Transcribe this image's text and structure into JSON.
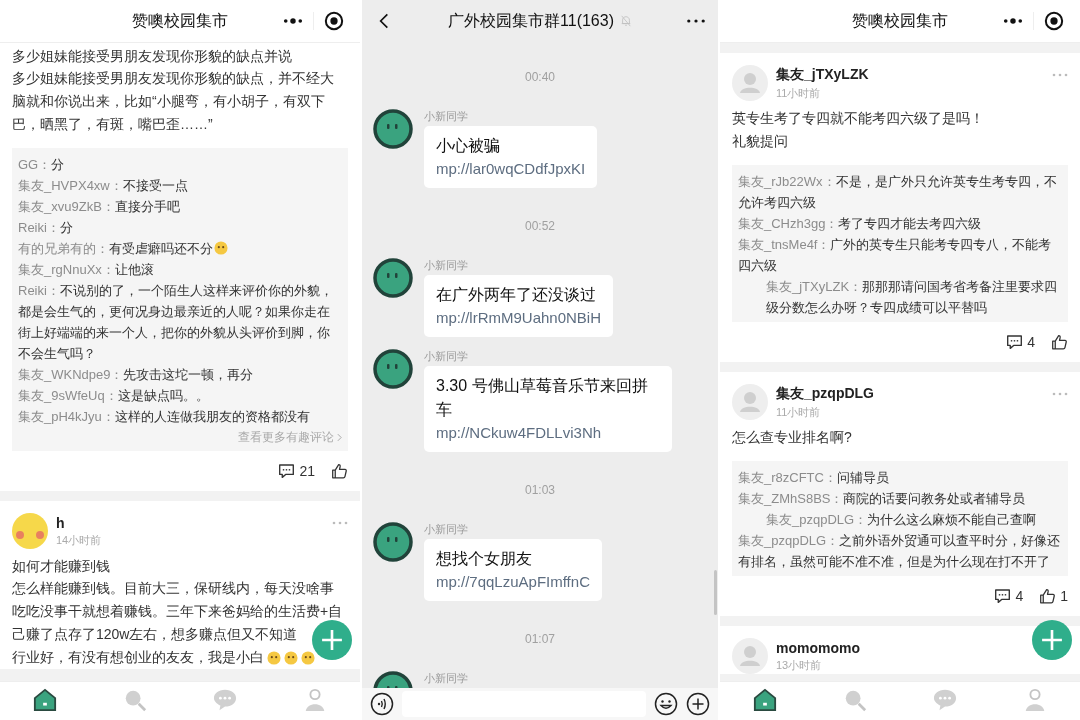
{
  "feed_left": {
    "title": "赞噢校园集市",
    "fab": true,
    "posts": [
      {
        "title": "多少姐妹能接受男朋友发现你形貌的缺点并说",
        "body_lines": [
          "多少姐妹能接受男朋友发现你形貌的缺点，并不经大",
          "脑就和你说出来，比如“小腿弯，有小胡子，有双下",
          "巴，晒黑了，有斑，嘴巴歪……”"
        ],
        "comments": [
          {
            "name": "GG：",
            "text": "分"
          },
          {
            "name": "集友_HVPX4xw：",
            "text": "不接受一点"
          },
          {
            "name": "集友_xvu9ZkB：",
            "text": "直接分手吧"
          },
          {
            "name": "Reiki：",
            "text": "分"
          },
          {
            "name": "有的兄弟有的：",
            "text": "有受虐癖吗还不分",
            "emoji": true
          },
          {
            "name": "集友_rgNnuXx：",
            "text": "让他滚"
          },
          {
            "name": "Reiki：",
            "text": "不说别的了，一个陌生人这样来评价你的外貌，都是会生气的，更何况身边最亲近的人呢？如果你走在街上好端端的来一个人，把你的外貌从头评价到脚，你不会生气吗？"
          },
          {
            "name": "集友_WKNdpe9：",
            "text": "先攻击这坨一顿，再分"
          },
          {
            "name": "集友_9sWfeUq：",
            "text": "这是缺点吗。。"
          },
          {
            "name": "集友_pH4kJyu：",
            "text": "这样的人连做我朋友的资格都没有"
          }
        ],
        "more_comments": "查看更多有趣评论",
        "comment_count": "21"
      },
      {
        "author": "h",
        "time": "14小时前",
        "avatar": {
          "kind": "cartoon"
        },
        "menu": true,
        "title": "如何才能赚到钱",
        "body_lines": [
          "怎么样能赚到钱。目前大三，保研线内，每天没啥事",
          "吃吃没事干就想着赚钱。三年下来爸妈给的生活费+自",
          "己赚了点存了120w左右，想多赚点但又不知道",
          "行业好，有没有想创业的友友，我是小白"
        ],
        "trailing_emojis": true
      }
    ],
    "tabs": [
      {
        "selected": true
      },
      {
        "selected": false
      },
      {
        "selected": false
      },
      {
        "selected": false
      }
    ]
  },
  "chat": {
    "title": "广外校园集市群11(163)",
    "muted": true,
    "items": [
      {
        "kind": "time",
        "text": "00:40"
      },
      {
        "kind": "message",
        "sender": "小新同学",
        "text": "小心被骗",
        "link": "mp://lar0wqCDdfJpxKI"
      },
      {
        "kind": "time",
        "text": "00:52"
      },
      {
        "kind": "message",
        "sender": "小新同学",
        "text": "在广外两年了还没谈过",
        "link": "mp://lrRmM9Uahn0NBiH"
      },
      {
        "kind": "message",
        "sender": "小新同学",
        "text": "3.30 号佛山草莓音乐节来回拼车",
        "link": "mp://NCkuw4FDLLvi3Nh"
      },
      {
        "kind": "time",
        "text": "01:03"
      },
      {
        "kind": "message",
        "sender": "小新同学",
        "text": "想找个女朋友",
        "link": "mp://7qqLzuApFImffnC"
      },
      {
        "kind": "time",
        "text": "01:07"
      },
      {
        "kind": "message",
        "sender": "小新同学"
      }
    ]
  },
  "feed_right": {
    "title": "赞噢校园集市",
    "fab": true,
    "posts": [
      {
        "author": "集友_jTXyLZK",
        "time": "11小时前",
        "avatar": {
          "kind": "default"
        },
        "menu": true,
        "body_lines": [
          "英专生考了专四就不能考四六级了是吗！",
          "礼貌提问"
        ],
        "comments": [
          {
            "name": "集友_rJb22Wx：",
            "text": "不是，是广外只允许英专生考专四，不允许考四六级"
          },
          {
            "name": "集友_CHzh3gg：",
            "text": "考了专四才能去考四六级"
          },
          {
            "name": "集友_tnsMe4f：",
            "text": "广外的英专生只能考专四专八，不能考四六级",
            "children": [
              {
                "name": "集友_jTXyLZK：",
                "text": "那那那请问国考省考备注里要求四级分数怎么办呀？专四成绩可以平替吗"
              }
            ]
          }
        ],
        "comment_count": "4"
      },
      {
        "author": "集友_pzqpDLG",
        "time": "11小时前",
        "avatar": {
          "kind": "default"
        },
        "menu": true,
        "body_lines": [
          "怎么查专业排名啊?"
        ],
        "comments": [
          {
            "name": "集友_r8zCFTC：",
            "text": "问辅导员"
          },
          {
            "name": "集友_ZMhS8BS：",
            "text": "商院的话要问教务处或者辅导员",
            "children": [
              {
                "name": "集友_pzqpDLG：",
                "text": "为什么这么麻烦不能自己查啊"
              }
            ]
          },
          {
            "name": "集友_pzqpDLG：",
            "text": "之前外语外贸通可以查平时分，好像还有排名，虽然可能不准不准，但是为什么现在打不开了"
          }
        ],
        "comment_count": "4",
        "like_count": "1"
      },
      {
        "author": "momomomo",
        "time": "13小时前",
        "avatar": {
          "kind": "default"
        }
      }
    ],
    "tabs": [
      {
        "selected": true
      },
      {
        "selected": false
      },
      {
        "selected": false
      },
      {
        "selected": false
      }
    ]
  }
}
